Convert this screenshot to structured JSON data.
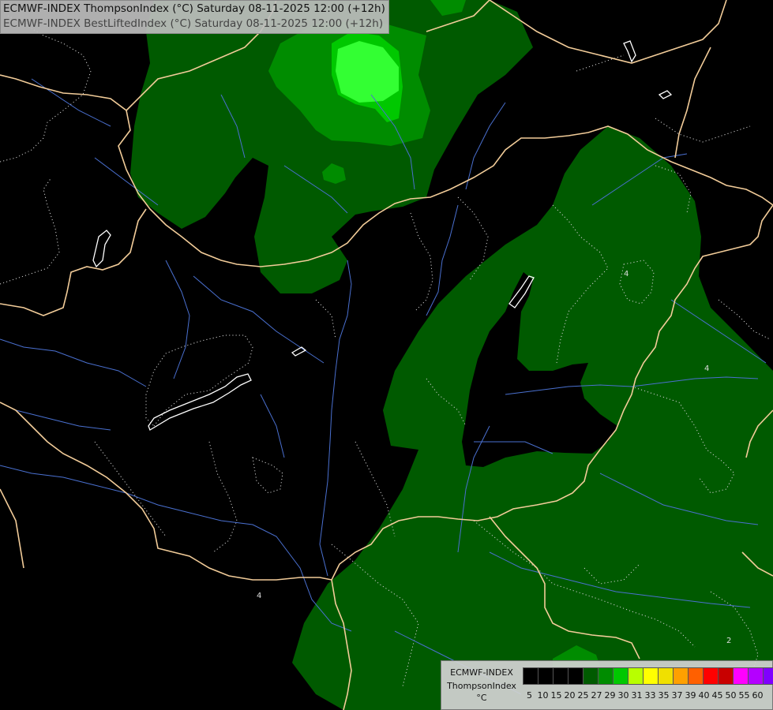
{
  "title": {
    "line1": "ECMWF-INDEX ThompsonIndex (°C) Saturday 08-11-2025 12:00 (+12h)",
    "line2": "ECMWF-INDEX BestLiftedIndex (°C) Saturday 08-11-2025 12:00 (+12h)"
  },
  "legend": {
    "model": "ECMWF-INDEX",
    "field": "ThompsonIndex",
    "unit": "°C",
    "ticks": [
      "5",
      "10",
      "15",
      "20",
      "25",
      "27",
      "29",
      "30",
      "31",
      "33",
      "35",
      "37",
      "39",
      "40",
      "45",
      "50",
      "55",
      "60"
    ],
    "colors": [
      "#000000",
      "#000000",
      "#000000",
      "#000000",
      "#005a00",
      "#008c00",
      "#00c800",
      "#b8ff00",
      "#ffff00",
      "#f0e000",
      "#ffa000",
      "#ff6000",
      "#ff0000",
      "#c80000",
      "#ff00ff",
      "#b400ff",
      "#8000ff",
      "#0000ff"
    ]
  },
  "contour_labels": [
    "4",
    "4",
    "4",
    "2"
  ],
  "colors": {
    "background": "#000000",
    "fill_dark": "#005a00",
    "fill_mid": "#008c00",
    "fill_light": "#00c800",
    "fill_bright": "#33ff33",
    "border": "#f2cc99",
    "river": "#4a70d0",
    "contour": "#cfcfcf"
  }
}
